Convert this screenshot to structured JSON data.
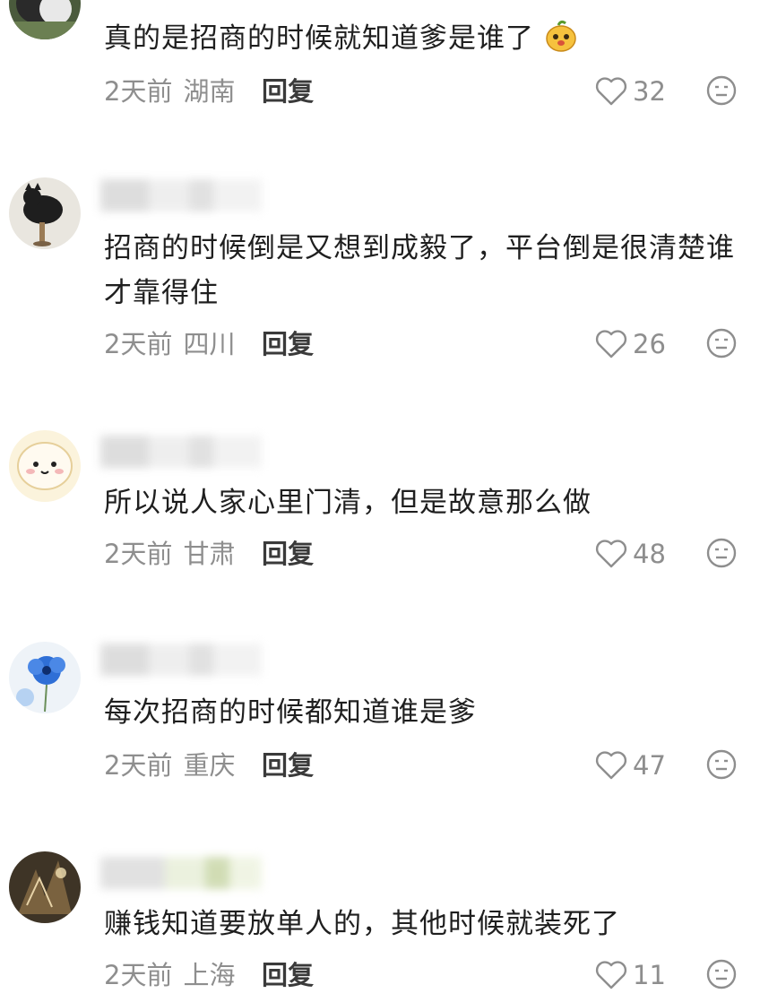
{
  "comments": [
    {
      "text": "真的是招商的时候就知道爹是谁了",
      "emoji": "yellow-cartoon-face-emoji",
      "time": "2天前",
      "location": "湖南",
      "reply_label": "回复",
      "likes": "32"
    },
    {
      "text": "招商的时候倒是又想到成毅了，平台倒是很清楚谁才靠得住",
      "time": "2天前",
      "location": "四川",
      "reply_label": "回复",
      "likes": "26"
    },
    {
      "text": "所以说人家心里门清，但是故意那么做",
      "time": "2天前",
      "location": "甘肃",
      "reply_label": "回复",
      "likes": "48"
    },
    {
      "text": "每次招商的时候都知道谁是爹",
      "time": "2天前",
      "location": "重庆",
      "reply_label": "回复",
      "likes": "47"
    },
    {
      "text": "赚钱知道要放单人的，其他时候就装死了",
      "time": "2天前",
      "location": "上海",
      "reply_label": "回复",
      "likes": "11"
    }
  ],
  "icons": {
    "like": "heart-outline-icon",
    "dislike": "neutral-face-icon"
  },
  "colors": {
    "text": "#1f1f1f",
    "meta": "#8e8e8e",
    "reply": "#3a3a3a"
  }
}
